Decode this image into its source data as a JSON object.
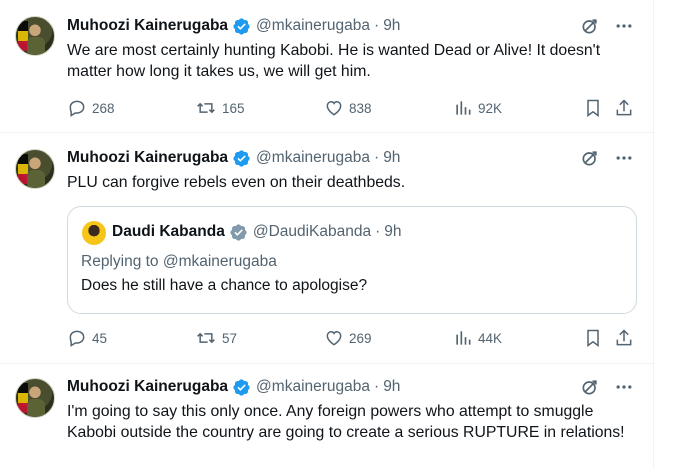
{
  "colors": {
    "verified_badge": "#1d9bf0",
    "secondary_text": "#536471",
    "primary_text": "#0f1419",
    "border": "#eff3f4"
  },
  "tweets": [
    {
      "name": "Muhoozi Kainerugaba",
      "handle": "@mkainerugaba",
      "dot": "·",
      "time": "9h",
      "text": "We are most certainly hunting Kabobi. He is wanted Dead or Alive! It doesn't matter how long it takes us, we will get him.",
      "replies": "268",
      "retweets": "165",
      "likes": "838",
      "views": "92K"
    },
    {
      "name": "Muhoozi Kainerugaba",
      "handle": "@mkainerugaba",
      "dot": "·",
      "time": "9h",
      "text": "PLU can forgive rebels even on their deathbeds.",
      "quote": {
        "name": "Daudi Kabanda",
        "handle": "@DaudiKabanda",
        "dot": "·",
        "time": "9h",
        "replying_to": "Replying to @mkainerugaba",
        "text": "Does he still have a chance to apologise?"
      },
      "replies": "45",
      "retweets": "57",
      "likes": "269",
      "views": "44K"
    },
    {
      "name": "Muhoozi Kainerugaba",
      "handle": "@mkainerugaba",
      "dot": "·",
      "time": "9h",
      "text": "I'm going to say this only once. Any foreign powers who attempt to smuggle Kabobi outside the country are going to create a serious RUPTURE in relations!"
    }
  ]
}
